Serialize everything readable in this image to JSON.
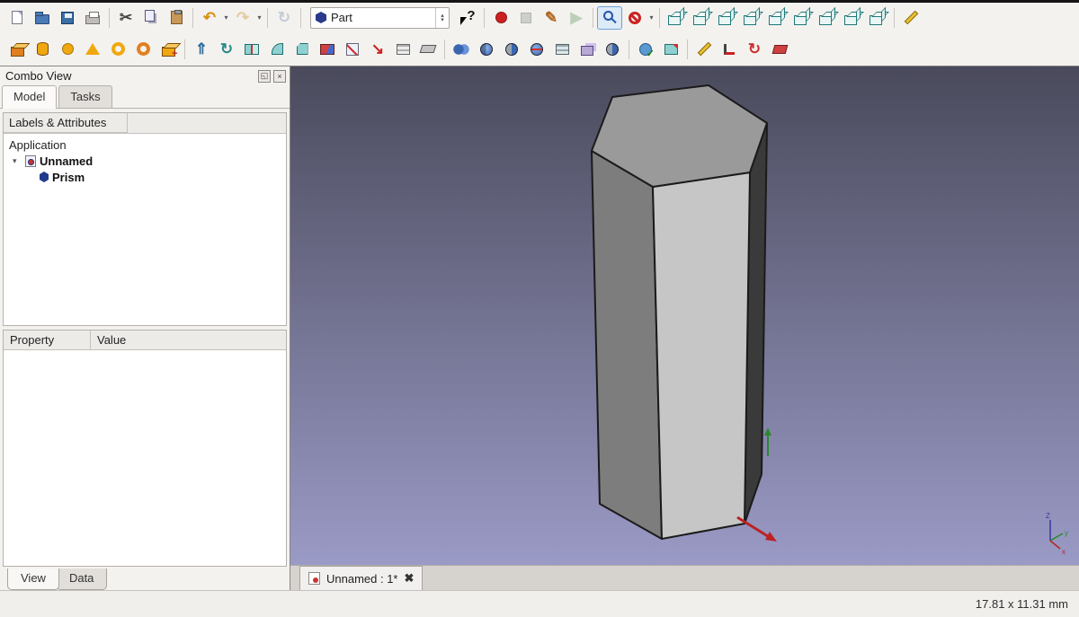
{
  "toolbar_row1_left": [
    {
      "name": "new-file",
      "shape": "doc"
    },
    {
      "name": "open-file",
      "shape": "folder"
    },
    {
      "name": "save-file",
      "shape": "save"
    },
    {
      "name": "print",
      "shape": "printer"
    },
    {
      "sep": true
    },
    {
      "name": "cut",
      "shape": "glyph",
      "glyph": "✂",
      "color": "#444444"
    },
    {
      "name": "copy",
      "shape": "copy"
    },
    {
      "name": "paste",
      "shape": "paste"
    },
    {
      "sep": true
    },
    {
      "name": "undo",
      "shape": "glyph",
      "glyph": "↶",
      "color": "#d89010",
      "dd": true
    },
    {
      "name": "redo",
      "shape": "glyph",
      "glyph": "↷",
      "color": "#c8a040",
      "dd": true,
      "disabled": true
    },
    {
      "sep": true
    },
    {
      "name": "refresh",
      "shape": "glyph",
      "glyph": "↻",
      "color": "#88a0b8",
      "disabled": true
    },
    {
      "sep": true
    }
  ],
  "workbench_selector": {
    "value": "Part"
  },
  "toolbar_row1_right": [
    {
      "name": "whats-this",
      "shape": "whatsthis"
    },
    {
      "sep": true
    },
    {
      "name": "macro-record",
      "shape": "circle",
      "color": "#cc2020"
    },
    {
      "name": "macro-stop",
      "shape": "rect",
      "color": "#9aa89a",
      "disabled": true
    },
    {
      "name": "macro-edit",
      "shape": "glyph",
      "glyph": "✎",
      "color": "#b06820"
    },
    {
      "name": "macro-play",
      "shape": "glyph",
      "glyph": "▶",
      "color": "#7aa87a",
      "disabled": true
    },
    {
      "sep": true
    },
    {
      "name": "zoom-fit",
      "shape": "magnifier",
      "boxed": true
    },
    {
      "name": "draw-style",
      "shape": "nosign",
      "dd": true
    },
    {
      "sep": true
    },
    {
      "name": "view-isometric",
      "shape": "cube"
    },
    {
      "name": "view-front",
      "shape": "cube"
    },
    {
      "name": "view-top",
      "shape": "cube"
    },
    {
      "name": "view-right",
      "shape": "cube"
    },
    {
      "name": "view-rear",
      "shape": "cube"
    },
    {
      "name": "view-bottom",
      "shape": "cube"
    },
    {
      "name": "view-left",
      "shape": "cube"
    },
    {
      "name": "view-axonometric",
      "shape": "cube"
    },
    {
      "name": "view-home",
      "shape": "cube"
    },
    {
      "sep": true
    },
    {
      "name": "measure-distance",
      "shape": "measure-lin"
    }
  ],
  "toolbar_row2": [
    {
      "name": "primitive-box",
      "shape": "box",
      "color": "#e08020"
    },
    {
      "name": "primitive-cylinder",
      "shape": "cylinder",
      "color": "#f0a810"
    },
    {
      "name": "primitive-sphere",
      "shape": "circle",
      "color": "#f0a810"
    },
    {
      "name": "primitive-cone",
      "shape": "triangle",
      "color": "#f0a810"
    },
    {
      "name": "primitive-torus",
      "shape": "ring",
      "color": "#f0a810"
    },
    {
      "name": "primitive-tube",
      "shape": "ring",
      "color": "#e08020"
    },
    {
      "name": "create-primitives",
      "shape": "box-plus",
      "color": "#f0a810"
    },
    {
      "sep": true
    },
    {
      "name": "extrude",
      "shape": "glyph",
      "glyph": "⇑",
      "color": "#2a6a9a"
    },
    {
      "name": "revolve",
      "shape": "glyph",
      "glyph": "↻",
      "color": "#2a8a8a"
    },
    {
      "name": "mirror",
      "shape": "mirror"
    },
    {
      "name": "fillet",
      "shape": "fillet"
    },
    {
      "name": "chamfer",
      "shape": "chamfer"
    },
    {
      "name": "ruled-surface",
      "shape": "ruled"
    },
    {
      "name": "loft",
      "shape": "loft"
    },
    {
      "name": "sweep",
      "shape": "glyph",
      "glyph": "↘",
      "color": "#cc2020"
    },
    {
      "name": "offset",
      "shape": "layers"
    },
    {
      "name": "thickness",
      "shape": "slab"
    },
    {
      "sep": true
    },
    {
      "name": "boolean-union",
      "shape": "spheres"
    },
    {
      "name": "boolean-common",
      "shape": "sphere-lens"
    },
    {
      "name": "boolean-cut",
      "shape": "sphere-cut"
    },
    {
      "name": "boolean-section",
      "shape": "sphere-section"
    },
    {
      "name": "cross-sections",
      "shape": "layers2"
    },
    {
      "name": "compound",
      "shape": "compound"
    },
    {
      "name": "boolean-operation",
      "shape": "sphere-cut"
    },
    {
      "sep": true
    },
    {
      "name": "check-geometry",
      "shape": "check"
    },
    {
      "name": "defeaturing",
      "shape": "defeature"
    },
    {
      "sep": true
    },
    {
      "name": "measure-linear",
      "shape": "measure-lin"
    },
    {
      "name": "measure-angular",
      "shape": "measure-ang"
    },
    {
      "name": "measure-refresh",
      "shape": "glyph",
      "glyph": "↻",
      "color": "#cc3030"
    },
    {
      "name": "measure-clear",
      "shape": "measure-clear"
    }
  ],
  "combo_view": {
    "title": "Combo View",
    "tabs": [
      {
        "label": "Model",
        "active": true
      },
      {
        "label": "Tasks",
        "active": false
      }
    ],
    "labels_header": "Labels & Attributes",
    "tree": {
      "root": "Application",
      "document": "Unnamed",
      "items": [
        "Prism"
      ]
    },
    "property_columns": [
      "Property",
      "Value"
    ],
    "bottom_tabs": [
      {
        "label": "View",
        "active": true
      },
      {
        "label": "Data",
        "active": false
      }
    ]
  },
  "document_tab": {
    "label": "Unnamed : 1*"
  },
  "viewport": {
    "bg_top": "#4a4a5c",
    "bg_bottom": "#9a9ac6",
    "prism": {
      "top": "#9a9a9a",
      "left": "#7d7d7d",
      "front": "#c6c6c6",
      "right": "#3a3a3a"
    },
    "axes": {
      "z": "Z",
      "y": "y",
      "x": "x"
    }
  },
  "status_bar": {
    "dimensions": "17.81 x 11.31 mm"
  }
}
